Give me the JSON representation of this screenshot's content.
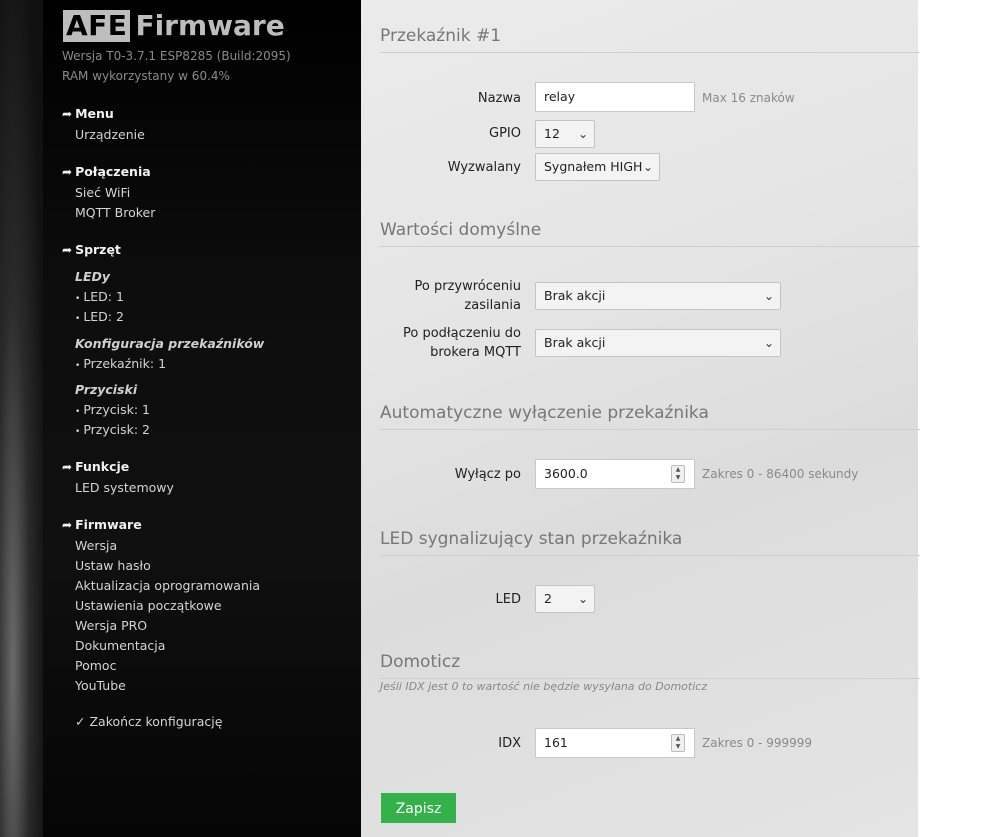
{
  "app": {
    "logo_badge": "AFE",
    "logo_text": "Firmware",
    "version": "Wersja T0-3.7.1 ESP8285 (Build:2095)",
    "ram": "RAM wykorzystany w 60.4%"
  },
  "sidebar": {
    "menu": {
      "title": "Menu",
      "items": [
        "Urządzenie"
      ]
    },
    "connections": {
      "title": "Połączenia",
      "items": [
        "Sieć WiFi",
        "MQTT Broker"
      ]
    },
    "hardware": {
      "title": "Sprzęt",
      "leds_title": "LEDy",
      "leds": [
        "LED: 1",
        "LED: 2"
      ],
      "relays_title": "Konfiguracja przekaźników",
      "relays": [
        "Przekaźnik: 1"
      ],
      "buttons_title": "Przyciski",
      "buttons": [
        "Przycisk: 1",
        "Przycisk: 2"
      ]
    },
    "functions": {
      "title": "Funkcje",
      "items": [
        "LED systemowy"
      ]
    },
    "firmware": {
      "title": "Firmware",
      "items": [
        "Wersja",
        "Ustaw hasło",
        "Aktualizacja oprogramowania",
        "Ustawienia początkowe",
        "Wersja PRO",
        "Dokumentacja",
        "Pomoc",
        "YouTube"
      ]
    },
    "finish": "Zakończ konfigurację"
  },
  "relay": {
    "title": "Przekaźnik #1",
    "name_label": "Nazwa",
    "name_value": "relay",
    "name_help": "Max 16 znaków",
    "gpio_label": "GPIO",
    "gpio_value": "12",
    "trigger_label": "Wyzwalany",
    "trigger_value": "Sygnałem HIGH"
  },
  "defaults": {
    "title": "Wartości domyślne",
    "power_label_1": "Po przywróceniu",
    "power_label_2": "zasilania",
    "power_value": "Brak akcji",
    "mqtt_label_1": "Po podłączeniu do",
    "mqtt_label_2": "brokera MQTT",
    "mqtt_value": "Brak akcji"
  },
  "auto_off": {
    "title": "Automatyczne wyłączenie przekaźnika",
    "label": "Wyłącz po",
    "value": "3600.0",
    "help": "Zakres 0 - 86400 sekundy"
  },
  "led": {
    "title": "LED sygnalizujący stan przekaźnika",
    "label": "LED",
    "value": "2"
  },
  "domoticz": {
    "title": "Domoticz",
    "hint": "Jeśli IDX jest 0 to wartość nie będzie wysyłana do Domoticz",
    "label": "IDX",
    "value": "161",
    "help": "Zakres 0 - 999999"
  },
  "save_label": "Zapisz",
  "colors": {
    "accent": "#35b14a",
    "sidebar": "#0d0d0d",
    "content": "#e5e5e5"
  }
}
